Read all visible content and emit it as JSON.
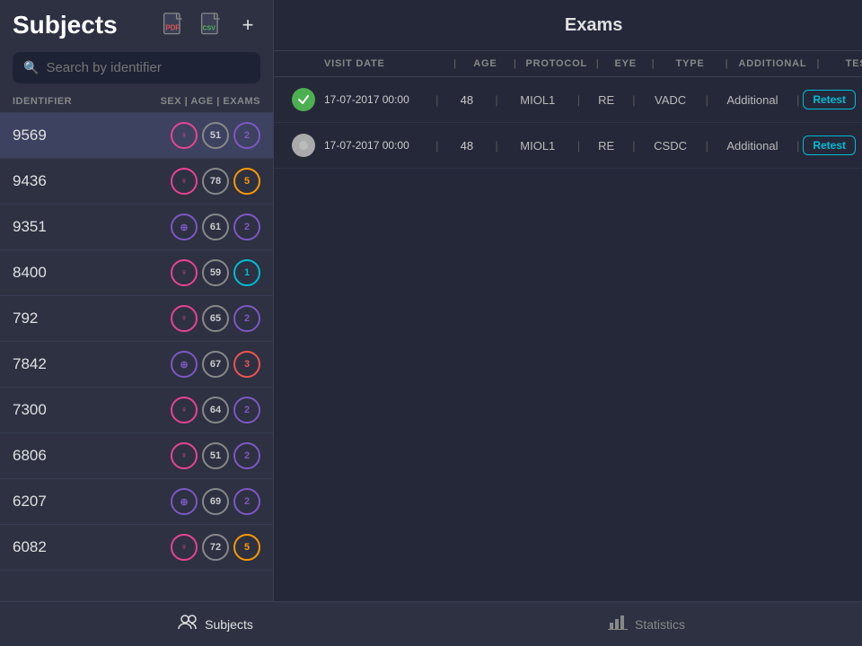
{
  "sidebar": {
    "title": "Subjects",
    "icons": [
      "doc-pdf",
      "doc-csv"
    ],
    "add_label": "+",
    "search_placeholder": "Search by identifier",
    "columns": {
      "identifier": "IDENTIFIER",
      "sex_age_exams": "SEX | AGE | EXAMS"
    },
    "subjects": [
      {
        "id": "9569",
        "sex": "female",
        "sex_symbol": "♀",
        "age": 51,
        "exams": 2,
        "exams_color": "c2",
        "active": true
      },
      {
        "id": "9436",
        "sex": "female",
        "sex_symbol": "♀",
        "age": 78,
        "exams": 5,
        "exams_color": "c5",
        "active": false
      },
      {
        "id": "9351",
        "sex": "other",
        "sex_symbol": "⊕",
        "age": 61,
        "exams": 2,
        "exams_color": "c2",
        "active": false
      },
      {
        "id": "8400",
        "sex": "female",
        "sex_symbol": "♀",
        "age": 59,
        "exams": 1,
        "exams_color": "c1",
        "active": false
      },
      {
        "id": "792",
        "sex": "female",
        "sex_symbol": "♀",
        "age": 65,
        "exams": 2,
        "exams_color": "c2",
        "active": false
      },
      {
        "id": "7842",
        "sex": "other",
        "sex_symbol": "⊕",
        "age": 67,
        "exams": 3,
        "exams_color": "c3",
        "active": false
      },
      {
        "id": "7300",
        "sex": "female",
        "sex_symbol": "♀",
        "age": 64,
        "exams": 2,
        "exams_color": "c2",
        "active": false
      },
      {
        "id": "6806",
        "sex": "female",
        "sex_symbol": "♀",
        "age": 51,
        "exams": 2,
        "exams_color": "c2",
        "active": false
      },
      {
        "id": "6207",
        "sex": "other",
        "sex_symbol": "⊕",
        "age": 69,
        "exams": 2,
        "exams_color": "c2",
        "active": false
      },
      {
        "id": "6082",
        "sex": "female",
        "sex_symbol": "♀",
        "age": 72,
        "exams": 5,
        "exams_color": "c5",
        "active": false
      }
    ]
  },
  "content": {
    "title": "Exams",
    "add_label": "+",
    "table_headers": {
      "visit_date": "VISIT DATE",
      "age": "AGE",
      "protocol": "PROTOCOL",
      "eye": "EYE",
      "type": "TYPE",
      "additional": "ADDITIONAL",
      "test": "TEST"
    },
    "exams": [
      {
        "status": "done",
        "visit_date": "17-07-2017 00:00",
        "age": 48,
        "protocol": "MIOL1",
        "eye": "RE",
        "type": "VADC",
        "additional": "Additional",
        "test_label": "Retest"
      },
      {
        "status": "pending",
        "visit_date": "17-07-2017 00:00",
        "age": 48,
        "protocol": "MIOL1",
        "eye": "RE",
        "type": "CSDC",
        "additional": "Additional",
        "test_label": "Retest"
      }
    ]
  },
  "bottom_nav": {
    "tabs": [
      {
        "id": "subjects",
        "label": "Subjects",
        "active": true
      },
      {
        "id": "statistics",
        "label": "Statistics",
        "active": false
      }
    ]
  }
}
